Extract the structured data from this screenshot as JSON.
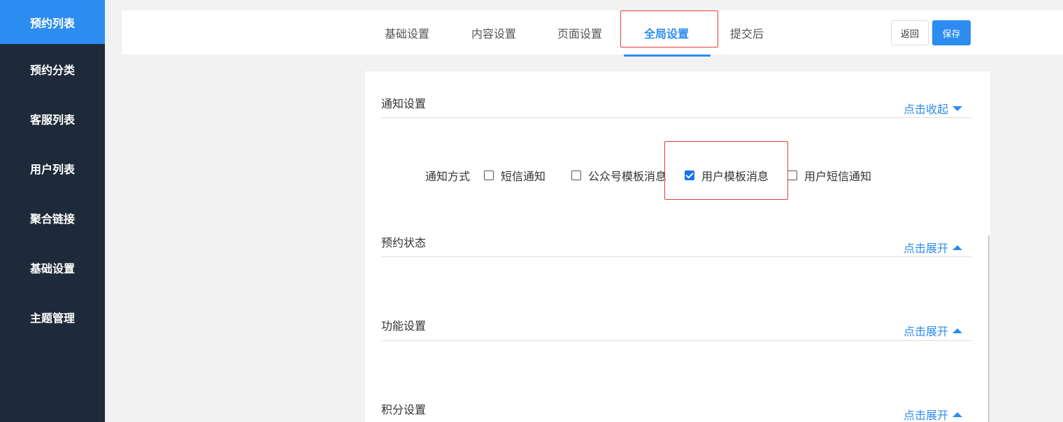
{
  "sidebar": {
    "items": [
      {
        "label": "预约列表",
        "active": true
      },
      {
        "label": "预约分类"
      },
      {
        "label": "客服列表"
      },
      {
        "label": "用户列表"
      },
      {
        "label": "聚合链接"
      },
      {
        "label": "基础设置"
      },
      {
        "label": "主题管理"
      }
    ]
  },
  "tabs": [
    {
      "label": "基础设置"
    },
    {
      "label": "内容设置"
    },
    {
      "label": "页面设置"
    },
    {
      "label": "全局设置",
      "active": true
    },
    {
      "label": "提交后"
    }
  ],
  "header": {
    "back_label": "返回",
    "save_label": "保存"
  },
  "sections": [
    {
      "title": "通知设置",
      "toggle": "点击收起",
      "expanded": true
    },
    {
      "title": "预约状态",
      "toggle": "点击展开",
      "expanded": false
    },
    {
      "title": "功能设置",
      "toggle": "点击展开",
      "expanded": false
    },
    {
      "title": "积分设置",
      "toggle": "点击展开",
      "expanded": false
    }
  ],
  "notify": {
    "label": "通知方式",
    "options": [
      {
        "label": "短信通知",
        "checked": false
      },
      {
        "label": "公众号模板消息",
        "checked": false
      },
      {
        "label": "用户模板消息",
        "checked": true
      },
      {
        "label": "用户短信通知",
        "checked": false
      }
    ]
  },
  "colors": {
    "accent": "#2d8cf0",
    "sidebar_bg": "#1e2a39",
    "highlight": "#e43c3c"
  }
}
